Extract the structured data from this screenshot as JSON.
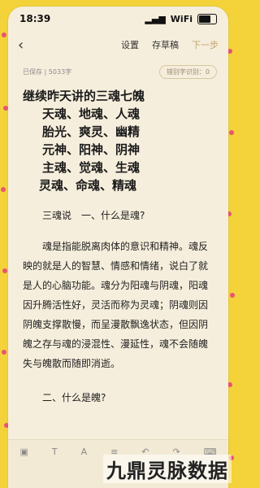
{
  "status": {
    "time": "18:39",
    "signal": "▂▄▆",
    "wifi": "WiFi",
    "battery_fill_percent": 70
  },
  "toolbar": {
    "back_icon": "chevron-left",
    "settings": "设置",
    "drafts": "存草稿",
    "next": "下一步"
  },
  "meta": {
    "saved": "已保存",
    "separator": "|",
    "word_count": "5033字",
    "typo_badge": "错别字识别：0"
  },
  "title": {
    "line1": "继续昨天讲的三魂七魄",
    "line2": "天魂、地魂、人魂",
    "line3": "胎光、爽灵、幽精",
    "line4": "元神、阳神、阴神",
    "line5": "主魂、觉魂、生魂",
    "line6": "灵魂、命魂、精魂"
  },
  "content": {
    "section1": "三魂说　一、什么是魂?",
    "para1": "魂是指能脱离肉体的意识和精神。魂反映的就是人的智慧、情感和情绪，说白了就是人的心脑功能。魂分为阳魂与阴魂，阳魂因升腾活性好，灵活而称为灵魂；阴魂则因阴魄支撑散慢，而呈漫散飘逸状态，但因阴魄之存与魂的浸混性、漫延性，魂不会随魄失与魄散而随即消逝。",
    "section2": "二、什么是魄?"
  },
  "watermark": "九鼎灵脉数据",
  "colors": {
    "outer_bg": "#f3d23a",
    "paper": "#f6eedc",
    "accent": "#c2a470",
    "dot": "#e6407a"
  }
}
